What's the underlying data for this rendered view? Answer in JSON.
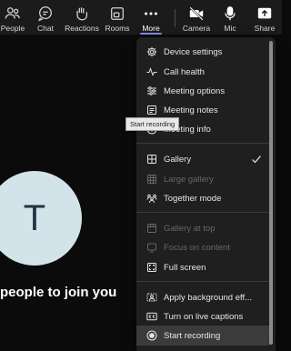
{
  "toolbar": {
    "items": [
      {
        "label": "People",
        "icon": "people-icon"
      },
      {
        "label": "Chat",
        "icon": "chat-icon"
      },
      {
        "label": "Reactions",
        "icon": "reactions-icon"
      },
      {
        "label": "Rooms",
        "icon": "rooms-icon"
      },
      {
        "label": "More",
        "icon": "more-icon",
        "active": true
      },
      {
        "label": "Camera",
        "icon": "camera-off-icon"
      },
      {
        "label": "Mic",
        "icon": "mic-icon"
      },
      {
        "label": "Share",
        "icon": "share-icon"
      }
    ],
    "accent": "#8b8cf2"
  },
  "stage": {
    "avatar_initial": "T",
    "avatar_color": "#d3e3ea",
    "invite_text": "people to join you"
  },
  "menu": {
    "items": [
      {
        "label": "Device settings",
        "icon": "gear-icon"
      },
      {
        "label": "Call health",
        "icon": "pulse-icon"
      },
      {
        "label": "Meeting options",
        "icon": "sliders-icon"
      },
      {
        "label": "Meeting notes",
        "icon": "notes-icon"
      },
      {
        "label": "Meeting info",
        "icon": "info-icon"
      },
      {
        "label": "Gallery",
        "icon": "gallery-icon",
        "checked": true
      },
      {
        "label": "Large gallery",
        "icon": "large-gallery-icon",
        "disabled": true
      },
      {
        "label": "Together mode",
        "icon": "together-mode-icon"
      },
      {
        "label": "Gallery at top",
        "icon": "gallery-top-icon",
        "disabled": true
      },
      {
        "label": "Focus on content",
        "icon": "focus-icon",
        "disabled": true
      },
      {
        "label": "Full screen",
        "icon": "fullscreen-icon"
      },
      {
        "label": "Apply background eff...",
        "icon": "background-effects-icon"
      },
      {
        "label": "Turn on live captions",
        "icon": "captions-icon"
      },
      {
        "label": "Start recording",
        "icon": "record-icon",
        "highlighted": true
      }
    ]
  },
  "tooltip": {
    "text": "Start recording"
  }
}
